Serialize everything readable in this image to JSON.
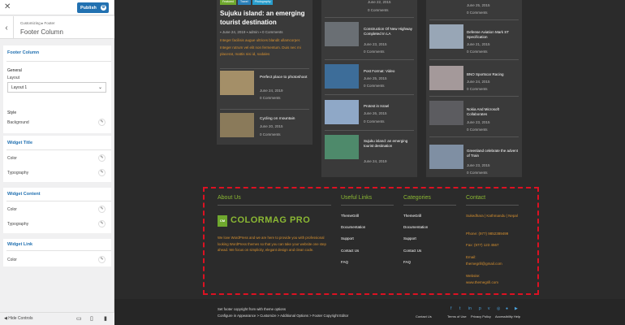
{
  "topbar": {
    "publish": "Publish"
  },
  "section": {
    "crumb": "Customizing ▸ Footer",
    "title": "Footer Column"
  },
  "groups": {
    "footer_column": {
      "title": "Footer Column",
      "general": "General",
      "layout_label": "Layout",
      "layout_value": "Layout 1",
      "style": "Style",
      "background": "Background"
    },
    "widget_title": {
      "title": "Widget Title",
      "color": "Color",
      "typography": "Typography"
    },
    "widget_content": {
      "title": "Widget Content",
      "color": "Color",
      "typography": "Typography"
    },
    "widget_link": {
      "title": "Widget Link",
      "color": "Color"
    }
  },
  "bottombar": {
    "hide": "Hide Controls"
  },
  "colors": {
    "accent": "#2271b1",
    "brand_green": "#8bb833",
    "dashed": "#dd1122"
  },
  "preview": {
    "featured": {
      "tags": [
        "Featured",
        "Travel",
        "Photography"
      ],
      "title": "Sujuku island: an emerging tourist destination",
      "meta_date": "June 24, 2019",
      "meta_author": "admin",
      "meta_comments": "0 Comments",
      "excerpt": "Integer facilisis augue ultrices blandit ullamcorper. Integer rutrum vel elit non fermentum. Duis nec mi placerat, mattis nisi id, sodales"
    },
    "left_list": [
      {
        "title": "Perfect place to photoshoot",
        "date": "June 24, 2019",
        "comments": "0 Comments"
      },
      {
        "title": "Cycling on mountain",
        "date": "June 20, 2015",
        "comments": "0 Comments"
      }
    ],
    "mid_list": [
      {
        "title": "",
        "date": "June 22, 2015",
        "comments": "0 Comments"
      },
      {
        "title": "Construction Of New Highway Completed In LA",
        "date": "June 23, 2015",
        "comments": "0 Comments"
      },
      {
        "title": "Post Format: Video",
        "date": "June 25, 2015",
        "comments": "0 Comments"
      },
      {
        "title": "Protest in Israel",
        "date": "June 26, 2015",
        "comments": "0 Comments"
      },
      {
        "title": "Sujuku island: an emerging tourist destination",
        "date": "June 24, 2019",
        "comments": ""
      }
    ],
    "right_list": [
      {
        "title": "",
        "date": "June 25, 2015",
        "comments": "0 Comments"
      },
      {
        "title": "Defense Aviation Mark ST Specification",
        "date": "June 21, 2015",
        "comments": "0 Comments"
      },
      {
        "title": "BNO Sportscar Racing",
        "date": "June 24, 2015",
        "comments": "0 Comments"
      },
      {
        "title": "Nokia And Microsoft Collaborates",
        "date": "June 23, 2015",
        "comments": "0 Comments"
      },
      {
        "title": "Greenland celebrate the advent of Train",
        "date": "June 23, 2015",
        "comments": "0 Comments"
      }
    ],
    "footer": {
      "about_title": "About Us",
      "logo_text": "COLORMAG PRO",
      "logo_badge": "CM",
      "about_text": "We love WordPress and we are here to provide you with professional looking WordPress themes so that you can take your website one step ahead. We focus on simplicity, elegant design and clean code.",
      "useful_title": "Useful Links",
      "useful_links": [
        "ThemeGrill",
        "Documentation",
        "Support",
        "Contact Us",
        "FAQ"
      ],
      "categories_title": "Categories",
      "categories": [
        "ThemeGrill",
        "Documentation",
        "Support",
        "Contact Us",
        "FAQ"
      ],
      "contact_title": "Contact",
      "contact_lines": [
        "Sukedhara | Kathmandu | Nepal",
        "Phone: (977) 9852389499",
        "Fax: (977) 123 4567",
        "Email:",
        "themegrill@gmail.com",
        "Website:",
        "www.themegrill.com"
      ],
      "copyright_1": "Set footer copyright from with theme options",
      "copyright_2": "Configure in Appearance > Customize > Additional Options > Footer Copyright Editor",
      "nav": [
        "Contact Us",
        "Terms of Use",
        "Privacy Policy",
        "Accessibility Help"
      ]
    }
  }
}
